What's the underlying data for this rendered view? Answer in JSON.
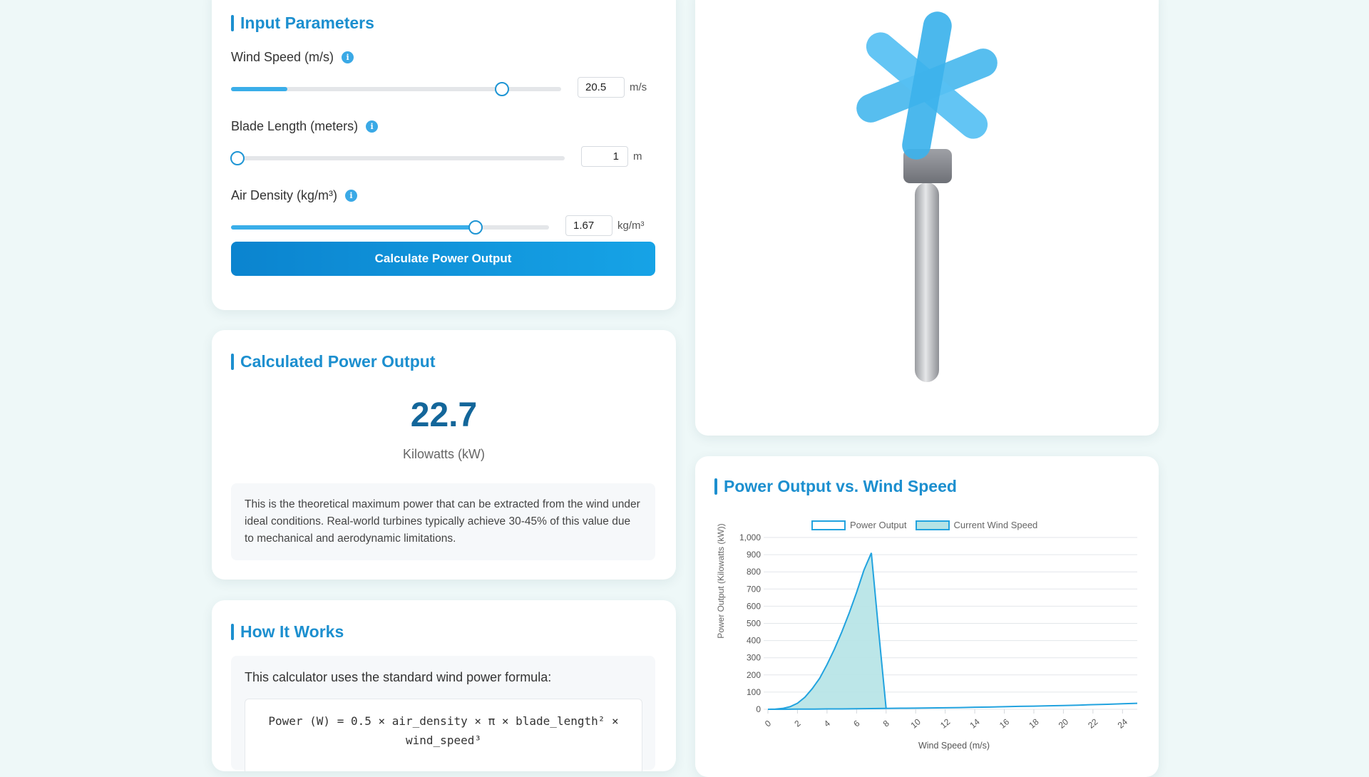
{
  "input_card": {
    "title": "Input Parameters",
    "wind_speed": {
      "label": "Wind Speed (m/s)",
      "value": "20.5",
      "unit": "m/s",
      "slider_fraction": 0.82,
      "fill_fraction": 0.17
    },
    "blade_length": {
      "label": "Blade Length (meters)",
      "value": "1",
      "unit": "m",
      "slider_fraction": 0.02
    },
    "air_density": {
      "label": "Air Density (kg/m³)",
      "value": "1.67",
      "unit": "kg/m³",
      "slider_fraction": 0.77,
      "fill_fraction": 0.77
    },
    "info_icon": "info-icon",
    "button_label": "Calculate Power Output"
  },
  "output_card": {
    "title": "Calculated Power Output",
    "value": "22.7",
    "unit": "Kilowatts (kW)",
    "note": "This is the theoretical maximum power that can be extracted from the wind under ideal conditions. Real-world turbines typically achieve 30-45% of this value due to mechanical and aerodynamic limitations."
  },
  "how_card": {
    "title": "How It Works",
    "intro": "This calculator uses the standard wind power formula:",
    "formula_line1": "Power (W) = 0.5 × air_density × π × blade_length² ×",
    "formula_line2": "wind_speed³"
  },
  "turbine": {
    "icon": "wind-turbine-icon"
  },
  "chart_card": {
    "title": "Power Output vs. Wind Speed"
  },
  "colors": {
    "accent": "#1c8fcf",
    "line": "#22a3df",
    "area_fill": "#b5e3e5",
    "button": "#0b84cf"
  },
  "chart_data": {
    "type": "line",
    "title": "",
    "xlabel": "Wind Speed (m/s)",
    "ylabel": "Power Output (Kilowatts (kW))",
    "ylim": [
      0,
      1000
    ],
    "y_ticks": [
      "0",
      "100",
      "200",
      "300",
      "400",
      "500",
      "600",
      "700",
      "800",
      "900",
      "1,000"
    ],
    "x_ticks": [
      "0",
      "2",
      "4",
      "6",
      "8",
      "10",
      "12",
      "14",
      "16",
      "18",
      "20",
      "22",
      "24"
    ],
    "xlim": [
      0,
      25
    ],
    "grid": true,
    "legend_position": "top-center",
    "series": [
      {
        "name": "Power Output",
        "x": [
          0,
          1,
          2,
          3,
          4,
          5,
          6,
          7,
          8,
          9,
          10,
          11,
          12,
          13,
          14,
          15,
          16,
          17,
          18,
          19,
          20,
          21,
          22,
          23,
          24,
          25
        ],
        "values": [
          0,
          0,
          1,
          1,
          2,
          2,
          3,
          4,
          5,
          6,
          7,
          8,
          9,
          10,
          12,
          13,
          15,
          17,
          18,
          20,
          22,
          24,
          27,
          29,
          32,
          35
        ]
      },
      {
        "name": "Current Wind Speed",
        "x": [
          0,
          0.5,
          1,
          1.5,
          2,
          2.5,
          3,
          3.5,
          4,
          4.5,
          5,
          5.5,
          6,
          6.5,
          7,
          7.5,
          8
        ],
        "values": [
          0,
          1,
          5,
          15,
          35,
          70,
          120,
          180,
          260,
          350,
          450,
          560,
          680,
          810,
          910,
          450,
          5
        ]
      }
    ]
  }
}
